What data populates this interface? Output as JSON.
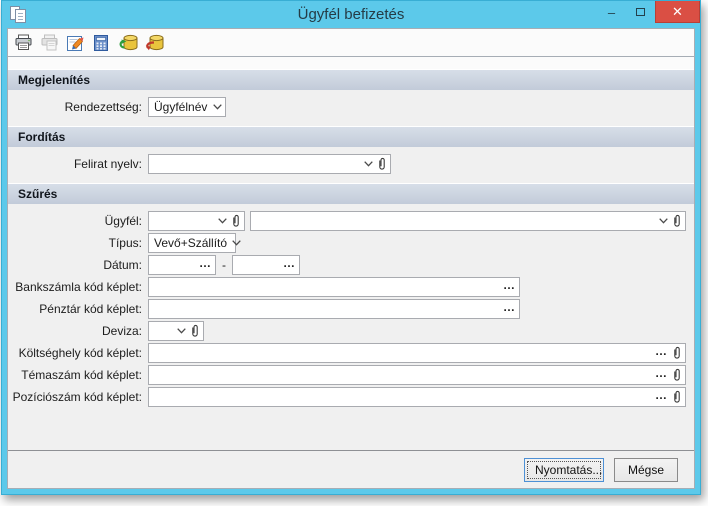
{
  "window": {
    "title": "Ügyfél befizetés",
    "minimize_glyph": "–",
    "close_glyph": "✕"
  },
  "colors": {
    "accent_titlebar": "#5cc9ea",
    "close_button": "#da4f44",
    "section_header_top": "#d7dee8",
    "section_header_bottom": "#c2cbd9",
    "content_background": "#f0f0f0"
  },
  "toolbar": {
    "icons": [
      "print-icon",
      "print-preview-icon",
      "design-icon",
      "calculator-icon",
      "database-import-icon",
      "database-export-icon"
    ]
  },
  "glyphs": {
    "ellipsis": "…"
  },
  "display": {
    "title": "Megjelenítés",
    "order_label": "Rendezettség:",
    "order_value": "Ügyfélnév"
  },
  "translation": {
    "title": "Fordítás",
    "language_label": "Felirat nyelv:",
    "language_value": ""
  },
  "filter": {
    "title": "Szűrés",
    "customer_label": "Ügyfél:",
    "customer_code_value": "",
    "customer_name_value": "",
    "type_label": "Típus:",
    "type_value": "Vevő+Szállító",
    "date_label": "Dátum:",
    "date_from_value": "",
    "date_separator": "-",
    "date_to_value": "",
    "bank_label": "Bankszámla kód képlet:",
    "bank_value": "",
    "cash_label": "Pénztár kód képlet:",
    "cash_value": "",
    "currency_label": "Deviza:",
    "currency_value": "",
    "costcenter_label": "Költséghely kód képlet:",
    "costcenter_value": "",
    "topic_label": "Témaszám kód képlet:",
    "topic_value": "",
    "position_label": "Pozíciószám kód képlet:",
    "position_value": ""
  },
  "footer": {
    "print": "Nyomtatás...",
    "cancel": "Mégse"
  }
}
